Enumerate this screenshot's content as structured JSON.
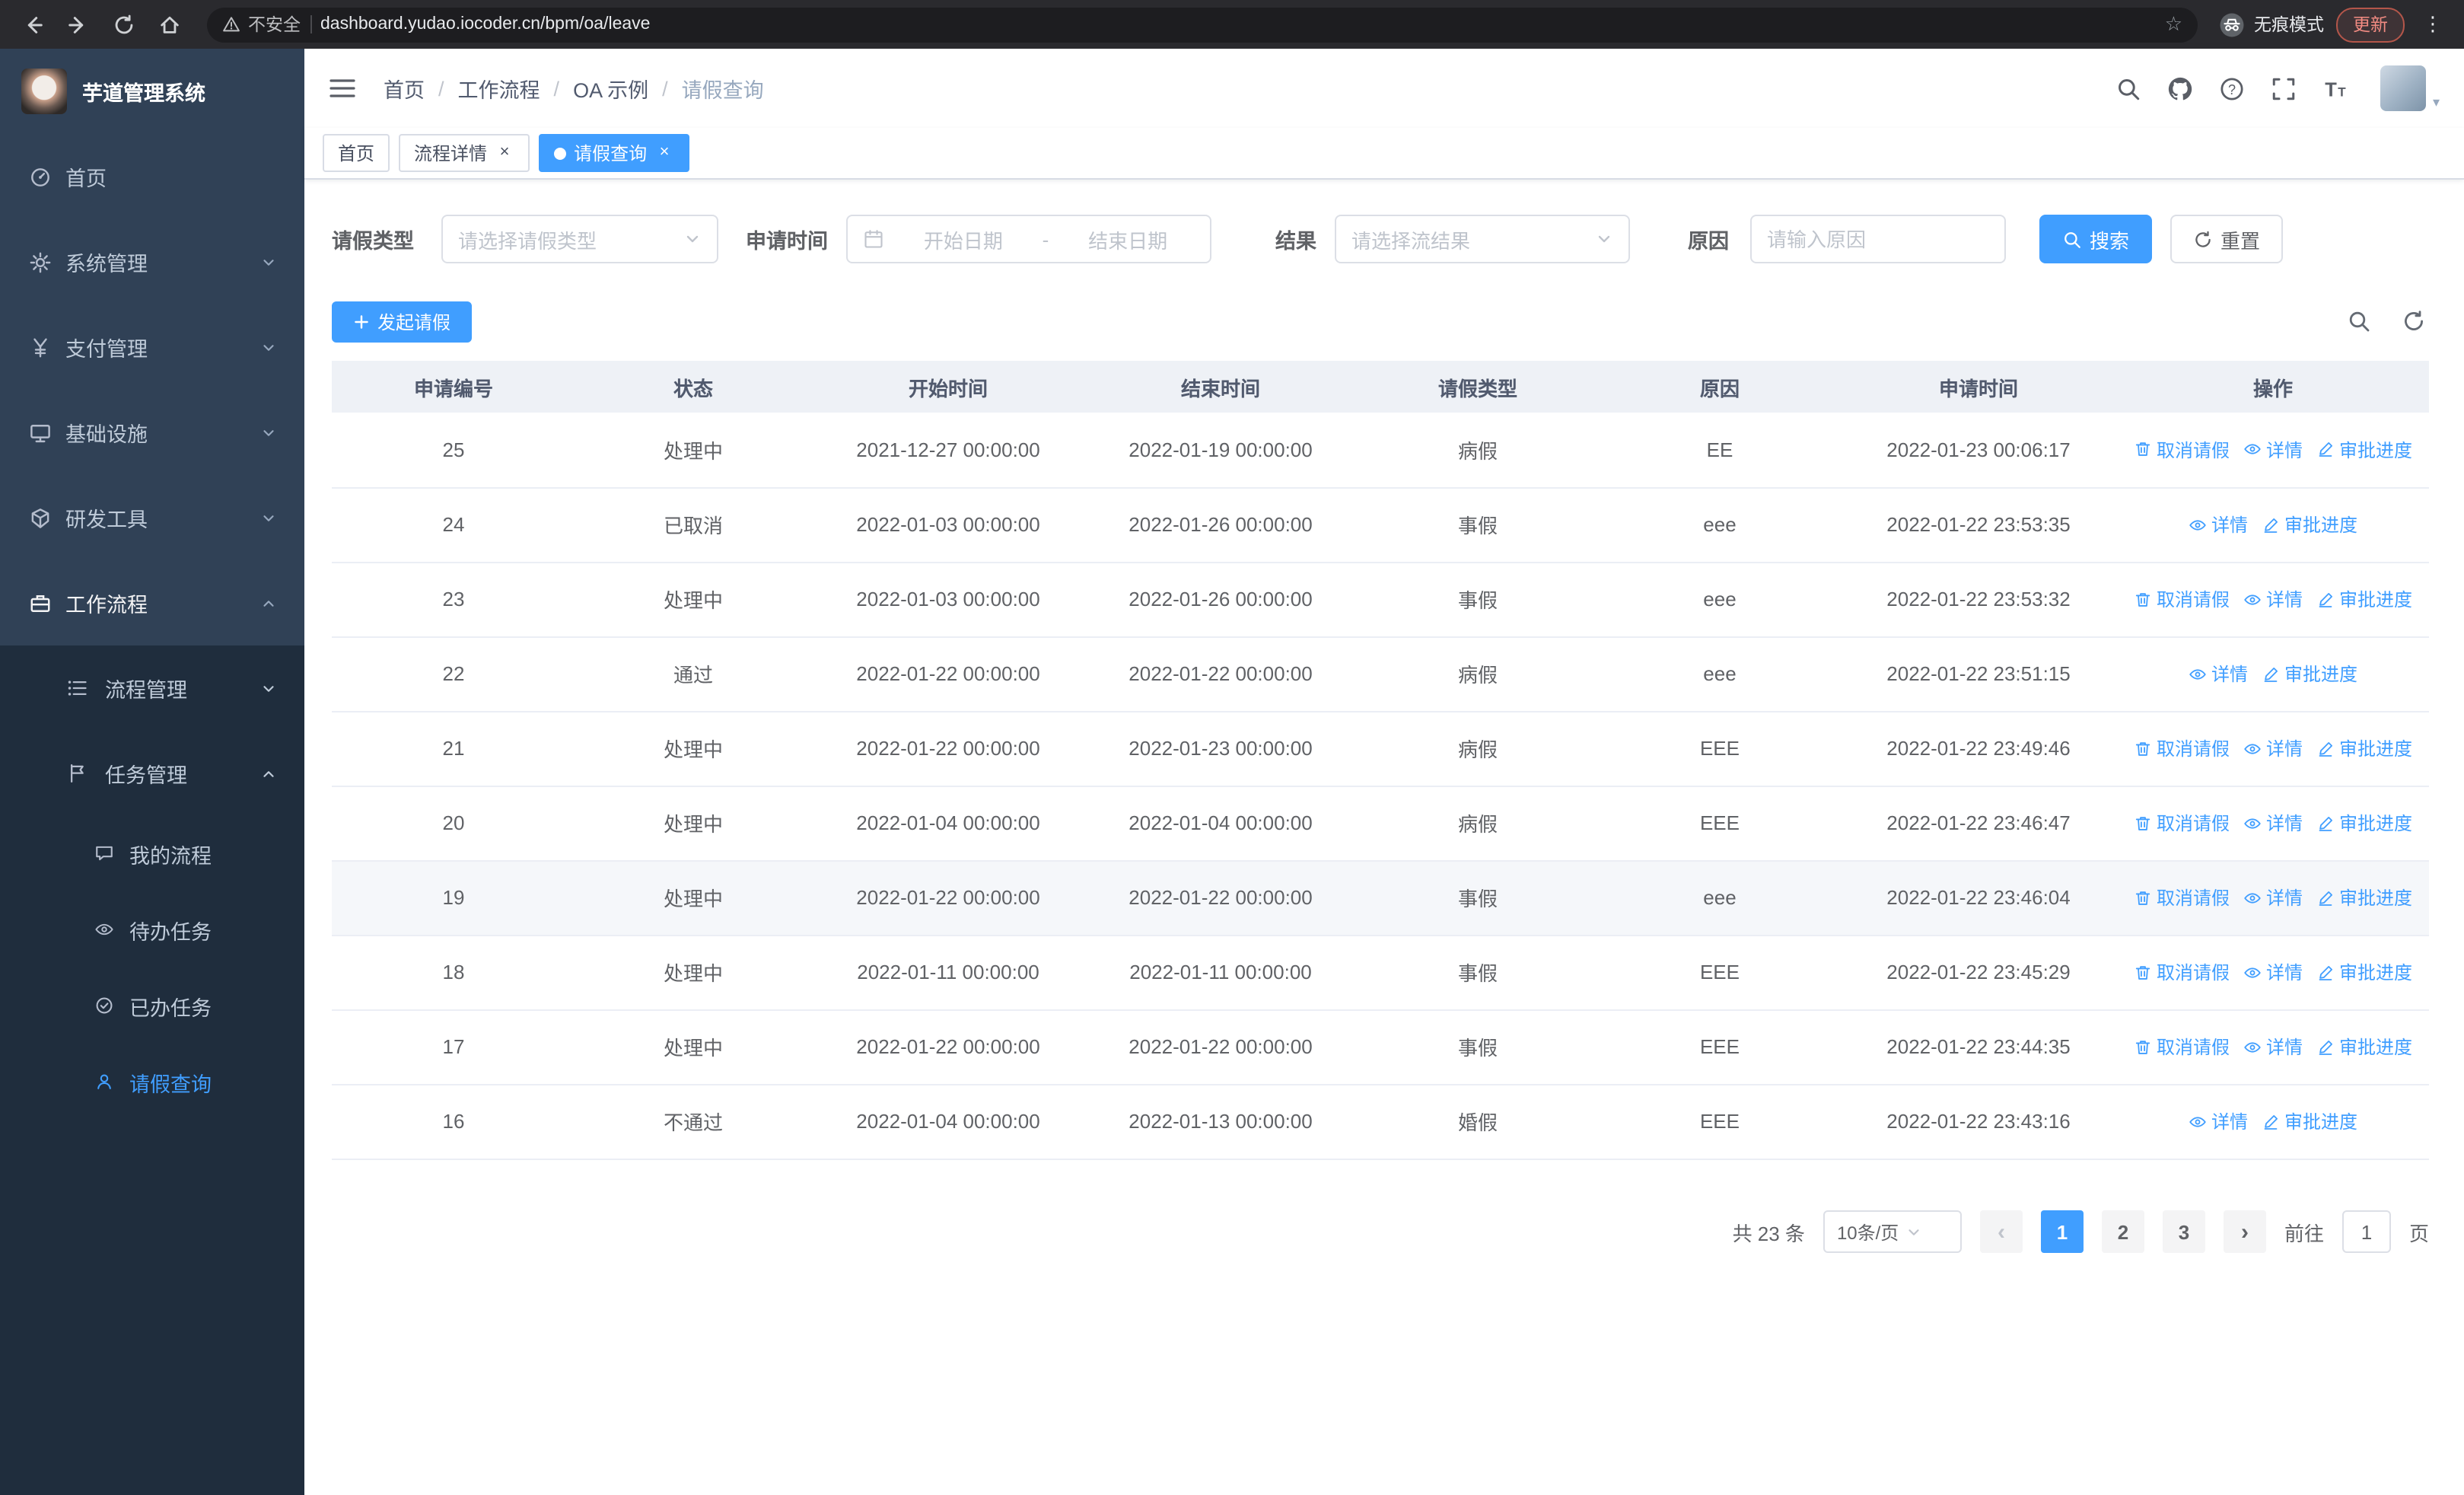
{
  "colors": {
    "primary": "#409eff"
  },
  "browser": {
    "security_warning": "不安全",
    "url": "dashboard.yudao.iocoder.cn/bpm/oa/leave",
    "incognito_label": "无痕模式",
    "update_button": "更新"
  },
  "sidebar": {
    "app_title": "芋道管理系统",
    "items": [
      {
        "label": "首页"
      },
      {
        "label": "系统管理"
      },
      {
        "label": "支付管理"
      },
      {
        "label": "基础设施"
      },
      {
        "label": "研发工具"
      },
      {
        "label": "工作流程"
      }
    ],
    "workflow_children": [
      {
        "label": "流程管理"
      },
      {
        "label": "任务管理"
      }
    ],
    "task_children": [
      {
        "label": "我的流程"
      },
      {
        "label": "待办任务"
      },
      {
        "label": "已办任务"
      },
      {
        "label": "请假查询"
      }
    ]
  },
  "header": {
    "breadcrumb": [
      "首页",
      "工作流程",
      "OA 示例",
      "请假查询"
    ]
  },
  "tabs": [
    {
      "label": "首页"
    },
    {
      "label": "流程详情"
    },
    {
      "label": "请假查询"
    }
  ],
  "filters": {
    "leave_type_label": "请假类型",
    "leave_type_placeholder": "请选择请假类型",
    "apply_time_label": "申请时间",
    "start_date_placeholder": "开始日期",
    "date_separator": "-",
    "end_date_placeholder": "结束日期",
    "result_label": "结果",
    "result_placeholder": "请选择流结果",
    "reason_label": "原因",
    "reason_placeholder": "请输入原因",
    "search_button": "搜索",
    "reset_button": "重置"
  },
  "toolbar": {
    "create_button": "发起请假"
  },
  "table": {
    "columns": [
      "申请编号",
      "状态",
      "开始时间",
      "结束时间",
      "请假类型",
      "原因",
      "申请时间",
      "操作"
    ],
    "actions": {
      "cancel": "取消请假",
      "detail": "详情",
      "progress": "审批进度"
    },
    "rows": [
      {
        "id": "25",
        "status": "处理中",
        "start": "2021-12-27 00:00:00",
        "end": "2022-01-19 00:00:00",
        "type": "病假",
        "reason": "EE",
        "applied": "2022-01-23 00:06:17",
        "cancellable": true,
        "hover": false
      },
      {
        "id": "24",
        "status": "已取消",
        "start": "2022-01-03 00:00:00",
        "end": "2022-01-26 00:00:00",
        "type": "事假",
        "reason": "eee",
        "applied": "2022-01-22 23:53:35",
        "cancellable": false,
        "hover": false
      },
      {
        "id": "23",
        "status": "处理中",
        "start": "2022-01-03 00:00:00",
        "end": "2022-01-26 00:00:00",
        "type": "事假",
        "reason": "eee",
        "applied": "2022-01-22 23:53:32",
        "cancellable": true,
        "hover": false
      },
      {
        "id": "22",
        "status": "通过",
        "start": "2022-01-22 00:00:00",
        "end": "2022-01-22 00:00:00",
        "type": "病假",
        "reason": "eee",
        "applied": "2022-01-22 23:51:15",
        "cancellable": false,
        "hover": false
      },
      {
        "id": "21",
        "status": "处理中",
        "start": "2022-01-22 00:00:00",
        "end": "2022-01-23 00:00:00",
        "type": "病假",
        "reason": "EEE",
        "applied": "2022-01-22 23:49:46",
        "cancellable": true,
        "hover": false
      },
      {
        "id": "20",
        "status": "处理中",
        "start": "2022-01-04 00:00:00",
        "end": "2022-01-04 00:00:00",
        "type": "病假",
        "reason": "EEE",
        "applied": "2022-01-22 23:46:47",
        "cancellable": true,
        "hover": false
      },
      {
        "id": "19",
        "status": "处理中",
        "start": "2022-01-22 00:00:00",
        "end": "2022-01-22 00:00:00",
        "type": "事假",
        "reason": "eee",
        "applied": "2022-01-22 23:46:04",
        "cancellable": true,
        "hover": true
      },
      {
        "id": "18",
        "status": "处理中",
        "start": "2022-01-11 00:00:00",
        "end": "2022-01-11 00:00:00",
        "type": "事假",
        "reason": "EEE",
        "applied": "2022-01-22 23:45:29",
        "cancellable": true,
        "hover": false
      },
      {
        "id": "17",
        "status": "处理中",
        "start": "2022-01-22 00:00:00",
        "end": "2022-01-22 00:00:00",
        "type": "事假",
        "reason": "EEE",
        "applied": "2022-01-22 23:44:35",
        "cancellable": true,
        "hover": false
      },
      {
        "id": "16",
        "status": "不通过",
        "start": "2022-01-04 00:00:00",
        "end": "2022-01-13 00:00:00",
        "type": "婚假",
        "reason": "EEE",
        "applied": "2022-01-22 23:43:16",
        "cancellable": false,
        "hover": false
      }
    ]
  },
  "pagination": {
    "total_text": "共 23 条",
    "page_size": "10条/页",
    "pages": [
      "1",
      "2",
      "3"
    ],
    "active_page": "1",
    "goto_label": "前往",
    "goto_value": "1",
    "goto_suffix": "页"
  }
}
